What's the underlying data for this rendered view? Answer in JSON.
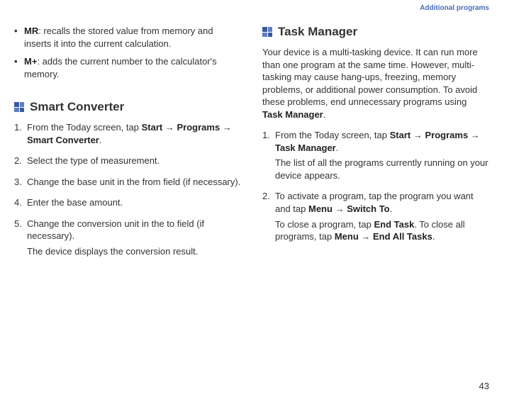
{
  "header": {
    "section_label": "Additional programs"
  },
  "page_number": "43",
  "left": {
    "bullets": [
      {
        "term": "MR",
        "desc": ": recalls the stored value from memory and inserts it into the current calculation."
      },
      {
        "term": "M+",
        "desc": ": adds the current number to the calculator's memory."
      }
    ],
    "heading": "Smart Converter",
    "steps": {
      "s1_pre": "From the Today screen, tap ",
      "s1_b1": "Start",
      "s1_arrow1": " → ",
      "s1_b2": "Programs",
      "s1_arrow2": " → ",
      "s1_b3": "Smart Converter",
      "s1_post": ".",
      "s2": "Select the type of measurement.",
      "s3": "Change the base unit in the from field (if necessary).",
      "s4": "Enter the base amount.",
      "s5": "Change the conversion unit in the to field (if necessary).",
      "s5_result": "The device displays the conversion result."
    }
  },
  "right": {
    "heading": "Task Manager",
    "intro_pre": "Your device is a multi-tasking device. It can run more than one program at the same time. However, multi-tasking may cause hang-ups, freezing, memory problems, or additional power consumption. To avoid these problems, end unnecessary programs using ",
    "intro_b": "Task Manager",
    "intro_post": ".",
    "steps": {
      "s1_pre": "From the Today screen, tap ",
      "s1_b1": "Start",
      "s1_arrow1": " → ",
      "s1_b2": "Programs",
      "s1_arrow2": " → ",
      "s1_b3": "Task Manager",
      "s1_post": ".",
      "s1_result": "The list of all the programs currently running on your device appears.",
      "s2_pre": "To activate a program, tap the program you want and tap ",
      "s2_b1": "Menu",
      "s2_arrow": " → ",
      "s2_b2": "Switch To",
      "s2_post": ".",
      "s2_close_pre": "To close a program, tap ",
      "s2_close_b1": "End Task",
      "s2_close_mid": ". To close all programs, tap ",
      "s2_close_b2": "Menu",
      "s2_close_arrow": " → ",
      "s2_close_b3": "End All Tasks",
      "s2_close_post": "."
    }
  }
}
